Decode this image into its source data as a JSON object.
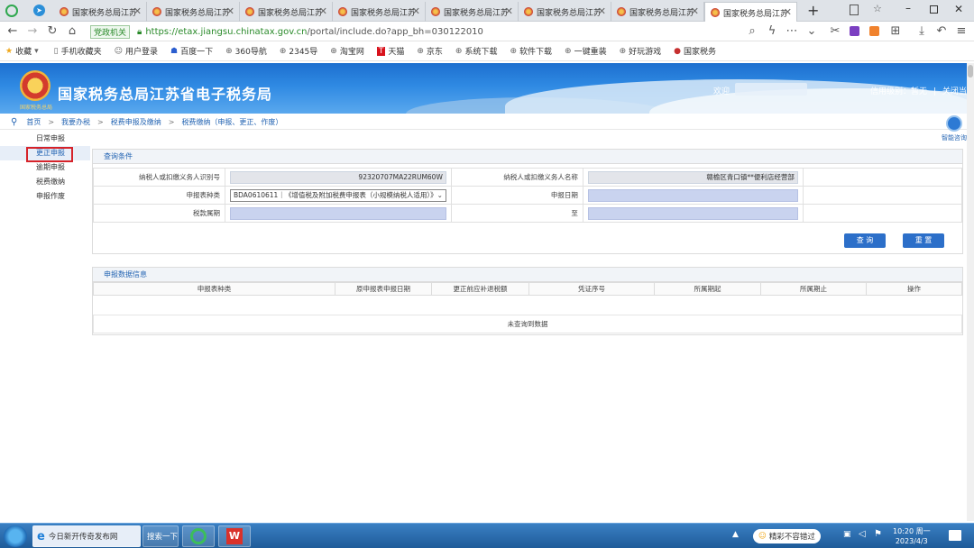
{
  "browser": {
    "tabs": [
      {
        "title": "国家税务总局江苏"
      },
      {
        "title": "国家税务总局江苏"
      },
      {
        "title": "国家税务总局江苏"
      },
      {
        "title": "国家税务总局江苏"
      },
      {
        "title": "国家税务总局江苏"
      },
      {
        "title": "国家税务总局江苏"
      },
      {
        "title": "国家税务总局江苏"
      },
      {
        "title": "国家税务总局江苏"
      }
    ],
    "security_label": "党政机关",
    "url_host": "https://etax.jiangsu.chinatax.gov.cn",
    "url_path": "/portal/include.do?app_bh=030122010",
    "bookmarks": [
      "收藏",
      "手机收藏夹",
      "用户登录",
      "百度一下",
      "360导航",
      "2345导",
      "淘宝网",
      "天猫",
      "京东",
      "系统下载",
      "软件下载",
      "一键重装",
      "好玩游戏",
      "国家税务"
    ]
  },
  "header": {
    "logo_sub": "国家税务总局",
    "title": "国家税务总局江苏省电子税务局",
    "welcome": "欢迎",
    "credit": "信用级别：暂无",
    "sep": "|",
    "close": "关闭当页"
  },
  "breadcrumb": {
    "items": [
      "首页",
      "我要办税",
      "税费申报及缴纳",
      "税费缴纳（申报、更正、作废）"
    ],
    "sep": ">"
  },
  "side_menu": {
    "items": [
      "日常申报",
      "更正申报",
      "逾期申报",
      "税费缴纳",
      "申报作废"
    ]
  },
  "helper": {
    "label": "智能咨询"
  },
  "query": {
    "title": "查询条件",
    "taxpayer_id_label": "纳税人或扣缴义务人识别号",
    "taxpayer_id_value": "92320707MA22RUM60W",
    "taxpayer_name_label": "纳税人或扣缴义务人名称",
    "taxpayer_name_value": "赣榆区青口镇**便利店经营部",
    "form_type_label": "申报表种类",
    "form_type_value": "BDA0610611｜《增值税及附加税费申报表（小规模纳税人适用）》",
    "date_label": "申报日期",
    "period_label": "税款属期",
    "to_label": "至",
    "query_button": "查 询",
    "reset_button": "重 置"
  },
  "results": {
    "title": "申报数据信息",
    "columns": [
      "申报表种类",
      "原申报表申报日期",
      "更正前应补退税额",
      "凭证序号",
      "所属期起",
      "所属期止",
      "操作"
    ],
    "empty": "未查询到数据"
  },
  "taskbar": {
    "ie_item": "今日新开传奇发布网",
    "search": "搜索一下",
    "tray_note": "精彩不容错过",
    "time": "10:20 周一",
    "date": "2023/4/3"
  }
}
